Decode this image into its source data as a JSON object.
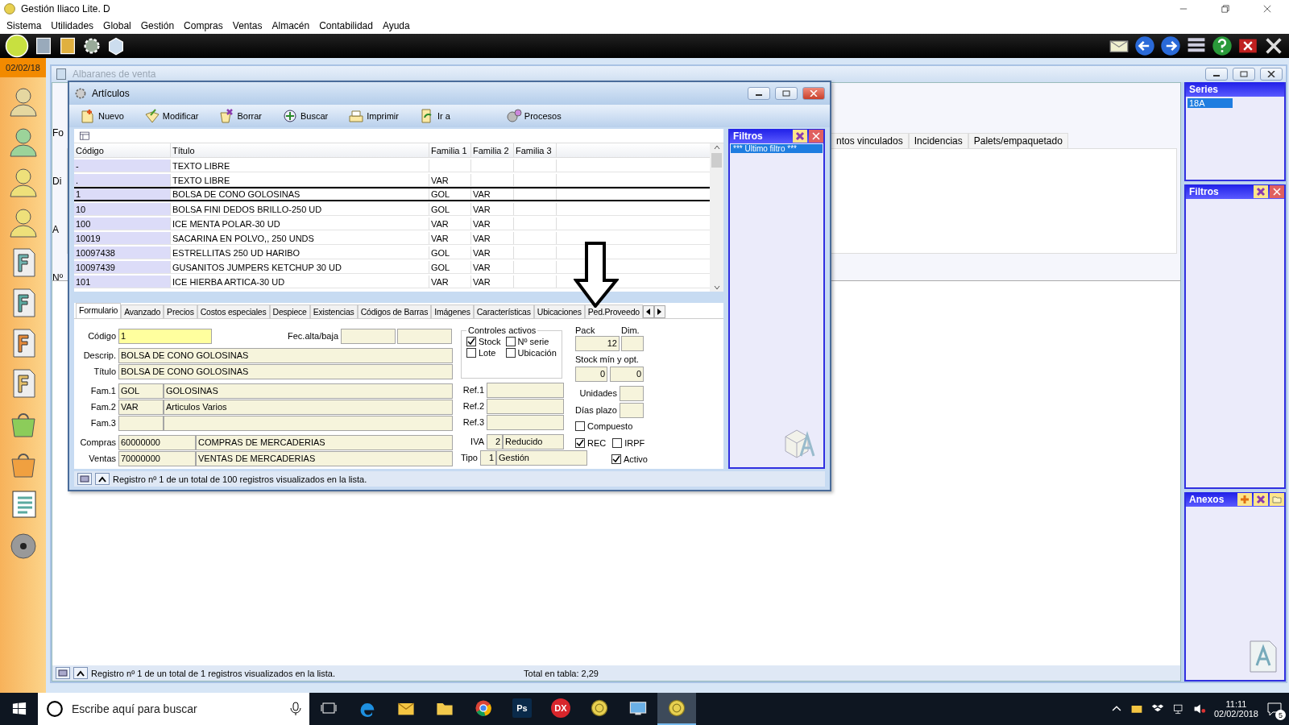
{
  "app_title": "Gestión Iliaco Lite. D",
  "menu": [
    "Sistema",
    "Utilidades",
    "Global",
    "Gestión",
    "Compras",
    "Ventas",
    "Almacén",
    "Contabilidad",
    "Ayuda"
  ],
  "sidebar_date": "02/02/18",
  "back_window": {
    "title": "Albaranes de venta",
    "side_labels": [
      "Fo",
      "Di",
      "A",
      "Nº"
    ],
    "tabs": [
      "ntos vinculados",
      "Incidencias",
      "Palets/empaquetado"
    ],
    "status": "Registro nº 1 de un total de 1 registros visualizados en la lista.",
    "total": "Total en tabla: 2,29"
  },
  "side_panels": {
    "series": {
      "title": "Series",
      "items": [
        {
          "label": "18A",
          "selected": true
        }
      ]
    },
    "filters": {
      "title": "Filtros"
    },
    "attachments": {
      "title": "Anexos"
    }
  },
  "articles_window": {
    "title": "Artículos",
    "toolbar": [
      {
        "kind": "new",
        "label": "Nuevo"
      },
      {
        "kind": "edit",
        "label": "Modificar"
      },
      {
        "kind": "delete",
        "label": "Borrar"
      },
      {
        "kind": "search",
        "label": "Buscar"
      },
      {
        "kind": "print",
        "label": "Imprimir"
      },
      {
        "kind": "goto",
        "label": "Ir a"
      },
      {
        "kind": "process",
        "label": "Procesos"
      }
    ],
    "columns": [
      "Código",
      "Título",
      "Familia 1",
      "Familia 2",
      "Familia 3"
    ],
    "rows": [
      {
        "cells": [
          "-",
          "TEXTO LIBRE",
          "",
          "",
          ""
        ],
        "selected": false
      },
      {
        "cells": [
          ".",
          "TEXTO LIBRE",
          "VAR",
          "",
          ""
        ],
        "selected": false
      },
      {
        "cells": [
          "1",
          "BOLSA DE CONO GOLOSINAS",
          "GOL",
          "VAR",
          ""
        ],
        "selected": true
      },
      {
        "cells": [
          "10",
          "BOLSA FINI DEDOS BRILLO-250 UD",
          "GOL",
          "VAR",
          ""
        ],
        "selected": false
      },
      {
        "cells": [
          "100",
          "ICE MENTA POLAR-30 UD",
          "VAR",
          "VAR",
          ""
        ],
        "selected": false
      },
      {
        "cells": [
          "10019",
          "SACARINA EN POLVO,, 250 UNDS",
          "VAR",
          "VAR",
          ""
        ],
        "selected": false
      },
      {
        "cells": [
          "10097438",
          "ESTRELLITAS 250 UD HARIBO",
          "GOL",
          "VAR",
          ""
        ],
        "selected": false
      },
      {
        "cells": [
          "10097439",
          "GUSANITOS JUMPERS KETCHUP 30 UD",
          "GOL",
          "VAR",
          ""
        ],
        "selected": false
      },
      {
        "cells": [
          "101",
          "ICE HIERBA ARTICA-30 UD",
          "VAR",
          "VAR",
          ""
        ],
        "selected": false
      }
    ],
    "filter_panel": {
      "title": "Filtros",
      "items": [
        {
          "label": "*** Último filtro ***",
          "selected": true
        }
      ]
    },
    "tabs": [
      {
        "label": "Formulario",
        "selected": true
      },
      {
        "label": "Avanzado",
        "selected": false
      },
      {
        "label": "Precios",
        "selected": false
      },
      {
        "label": "Costos especiales",
        "selected": false
      },
      {
        "label": "Despiece",
        "selected": false
      },
      {
        "label": "Existencias",
        "selected": false
      },
      {
        "label": "Códigos de Barras",
        "selected": false
      },
      {
        "label": "Imágenes",
        "selected": false
      },
      {
        "label": "Características",
        "selected": false
      },
      {
        "label": "Ubicaciones",
        "selected": false
      },
      {
        "label": "Ped.Proveedo",
        "selected": false
      }
    ],
    "form": {
      "code": {
        "label": "Código",
        "value": "1"
      },
      "dates": {
        "label": "Fec.alta/baja"
      },
      "description": {
        "label": "Descrip.",
        "value": "BOLSA DE CONO GOLOSINAS"
      },
      "title": {
        "label": "Título",
        "value": "BOLSA DE CONO GOLOSINAS"
      },
      "families": [
        {
          "label": "Fam.1",
          "code": "GOL",
          "name": "GOLOSINAS"
        },
        {
          "label": "Fam.2",
          "code": "VAR",
          "name": "Articulos Varios"
        },
        {
          "label": "Fam.3"
        }
      ],
      "accounts": [
        {
          "label": "Compras",
          "code": "60000000",
          "name": "COMPRAS DE MERCADERIAS"
        },
        {
          "label": "Ventas",
          "code": "70000000",
          "name": "VENTAS DE MERCADERIAS"
        }
      ],
      "controls": {
        "title": "Controles activos",
        "items": [
          {
            "label": "Stock",
            "checked": true
          },
          {
            "label": "Nº serie",
            "checked": false
          },
          {
            "label": "Lote",
            "checked": false
          },
          {
            "label": "Ubicación",
            "checked": false
          }
        ]
      },
      "refs": [
        {
          "label": "Ref.1"
        },
        {
          "label": "Ref.2"
        },
        {
          "label": "Ref.3"
        }
      ],
      "tax": {
        "label": "IVA",
        "code": "2",
        "name": "Reducido"
      },
      "type": {
        "label": "Tipo",
        "code": "1",
        "name": "Gestión"
      },
      "pack": {
        "label": "Pack",
        "value": "12"
      },
      "dim": {
        "label": "Dim."
      },
      "stock": {
        "label": "Stock mín y opt.",
        "min": "0",
        "opt": "0"
      },
      "units": {
        "label": "Unidades"
      },
      "lead_days": {
        "label": "Días plazo"
      },
      "compound": {
        "label": "Compuesto",
        "checked": false
      },
      "rec": {
        "label": "REC",
        "checked": true
      },
      "irpf": {
        "label": "IRPF",
        "checked": false
      },
      "active": {
        "label": "Activo",
        "checked": true
      }
    },
    "status": "Registro nº 1 de un total de 100 registros visualizados en la lista."
  },
  "taskbar": {
    "search_placeholder": "Escribe aquí para buscar",
    "apps": [
      {
        "kind": "edge",
        "active": false
      },
      {
        "kind": "mail",
        "active": false
      },
      {
        "kind": "folder",
        "active": false
      },
      {
        "kind": "chrome",
        "active": false
      },
      {
        "kind": "badge",
        "label": "Ps",
        "color": "#0a2a4a",
        "active": false
      },
      {
        "kind": "round",
        "label": "DX",
        "color": "#d8262c",
        "active": false
      },
      {
        "kind": "coin",
        "active": false
      },
      {
        "kind": "monitor",
        "active": false
      },
      {
        "kind": "coin",
        "active": true
      }
    ],
    "time": "11:11",
    "date": "02/02/2018",
    "notifications": "5"
  }
}
